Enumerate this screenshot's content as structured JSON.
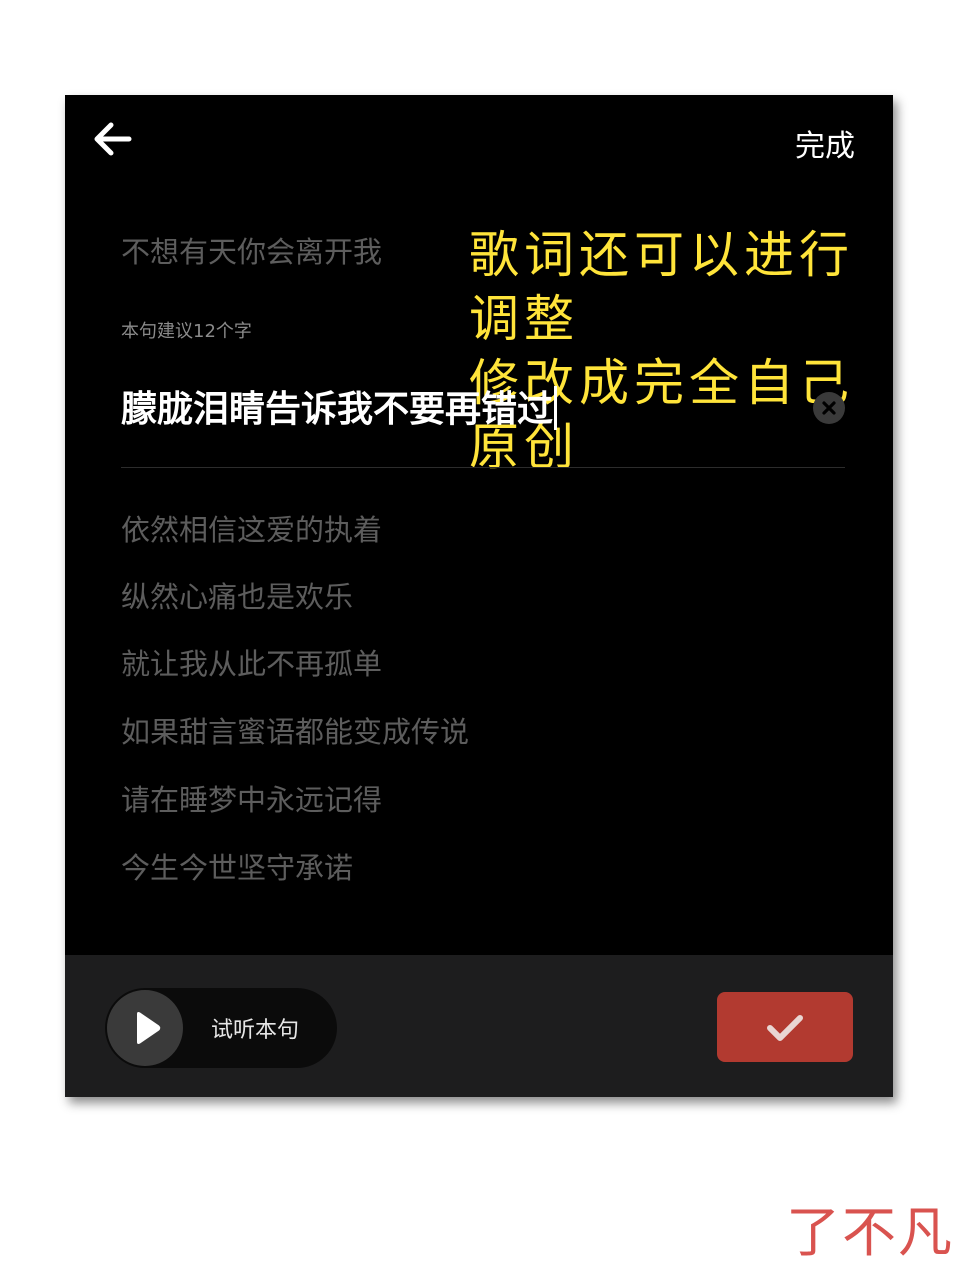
{
  "header": {
    "back_icon": "arrow-left-icon",
    "done_label": "完成"
  },
  "lyrics": {
    "previous_line": "不想有天你会离开我",
    "hint": "本句建议12个字",
    "current_line": "朦胧泪睛告诉我不要再错过",
    "following_lines": [
      "依然相信这爱的执着",
      "纵然心痛也是欢乐",
      "就让我从此不再孤单",
      "如果甜言蜜语都能变成传说",
      "请在睡梦中永远记得",
      "今生今世坚守承诺"
    ]
  },
  "annotation": {
    "line1": "歌词还可以进行调整",
    "line2": "修改成完全自己原创"
  },
  "bottom_bar": {
    "preview_label": "试听本句",
    "play_icon": "play-icon",
    "confirm_icon": "checkmark-icon"
  },
  "watermark": "了不凡",
  "colors": {
    "background": "#000000",
    "annotation": "#ffe43a",
    "confirm_button": "#b23a30",
    "watermark": "#d9534f"
  }
}
